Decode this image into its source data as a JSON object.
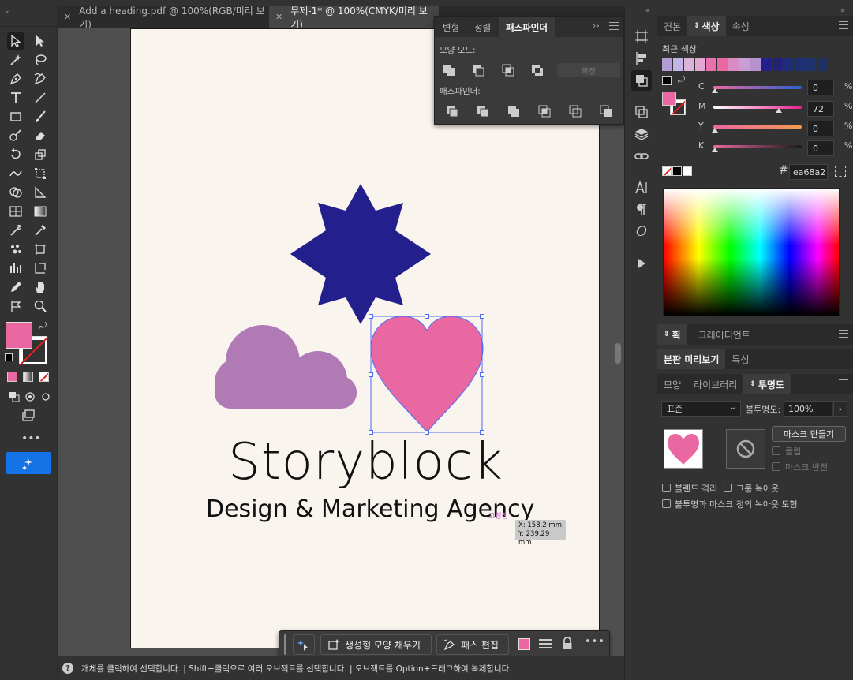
{
  "colors": {
    "accent_blue": "#1473e6",
    "fill_color": "#ea68a2",
    "star": "#231f8c",
    "cloud": "#b07ab5",
    "heart": "#ea68a2",
    "artboard_bg": "#faf4ee",
    "selection": "#4a6cf7"
  },
  "document_tabs": [
    {
      "label": "Add a heading.pdf @ 100%(RGB/미리 보기)",
      "close_icon": "close-icon",
      "active": false
    },
    {
      "label": "무제-1* @ 100%(CMYK/미리 보기)",
      "close_icon": "close-icon",
      "active": true
    }
  ],
  "artboard": {
    "title": "Storyblock",
    "subtitle": "Design & Marketing Agency",
    "cursor_label": "고정점",
    "coords": {
      "x_label": "X: 158.2 mm",
      "y_label": "Y: 239.29 mm"
    }
  },
  "pathfinder_panel": {
    "tabs": [
      "변형",
      "정렬",
      "패스파인더"
    ],
    "active_tab": "패스파인더",
    "shape_modes_label": "모양 모드:",
    "expand_label": "확장",
    "pathfinders_label": "패스파인더:"
  },
  "swatch_panel": {
    "tabs": [
      "견본",
      "색상",
      "속성"
    ],
    "active_tab": "색상",
    "recent_colors_label": "최근 색상",
    "recent_colors": [
      "#b59cd6",
      "#c2b4e4",
      "#d9b3d9",
      "#e3a8d2",
      "#e96fae",
      "#ea68a2",
      "#d98cc3",
      "#c99ed5",
      "#b692cf",
      "#231f8c",
      "#23237a",
      "#1f2e7a",
      "#1b3173",
      "#20336e",
      "#203060"
    ],
    "channels": [
      {
        "name": "C",
        "value": "0",
        "unit": "%"
      },
      {
        "name": "M",
        "value": "72",
        "unit": "%"
      },
      {
        "name": "Y",
        "value": "0",
        "unit": "%"
      },
      {
        "name": "K",
        "value": "0",
        "unit": "%"
      }
    ],
    "hex_symbol": "#",
    "hex_value": "ea68a2"
  },
  "stroke_panel": {
    "tabs": [
      "획",
      "그레이디언트"
    ],
    "active_tab": "획"
  },
  "separation_panel": {
    "tabs": [
      "분판 미리보기",
      "특성"
    ],
    "active_tab": "분판 미리보기"
  },
  "transparency_panel": {
    "tabs": [
      "모양",
      "라이브러리",
      "투명도"
    ],
    "active_tab": "투명도",
    "blend_mode": "표준",
    "opacity_label": "불투명도:",
    "opacity_value": "100%",
    "make_mask_label": "마스크 만들기",
    "clip_label": "클립",
    "invert_mask_label": "마스크 반전",
    "isolate_blending_label": "블렌드 격리",
    "knockout_group_label": "그룹 녹아웃",
    "opacity_mask_label": "불투명과 마스크 정의 녹아웃 도형"
  },
  "context_bar": {
    "generative_fill_label": "생성형 모양 채우기",
    "edit_path_label": "패스 편집"
  },
  "status_bar": {
    "text": "개체를 클릭하여 선택합니다.  |  Shift+클릭으로 여러 오브젝트를 선택합니다.  |  오브젝트를 Option+드래그하여 복제합니다."
  }
}
